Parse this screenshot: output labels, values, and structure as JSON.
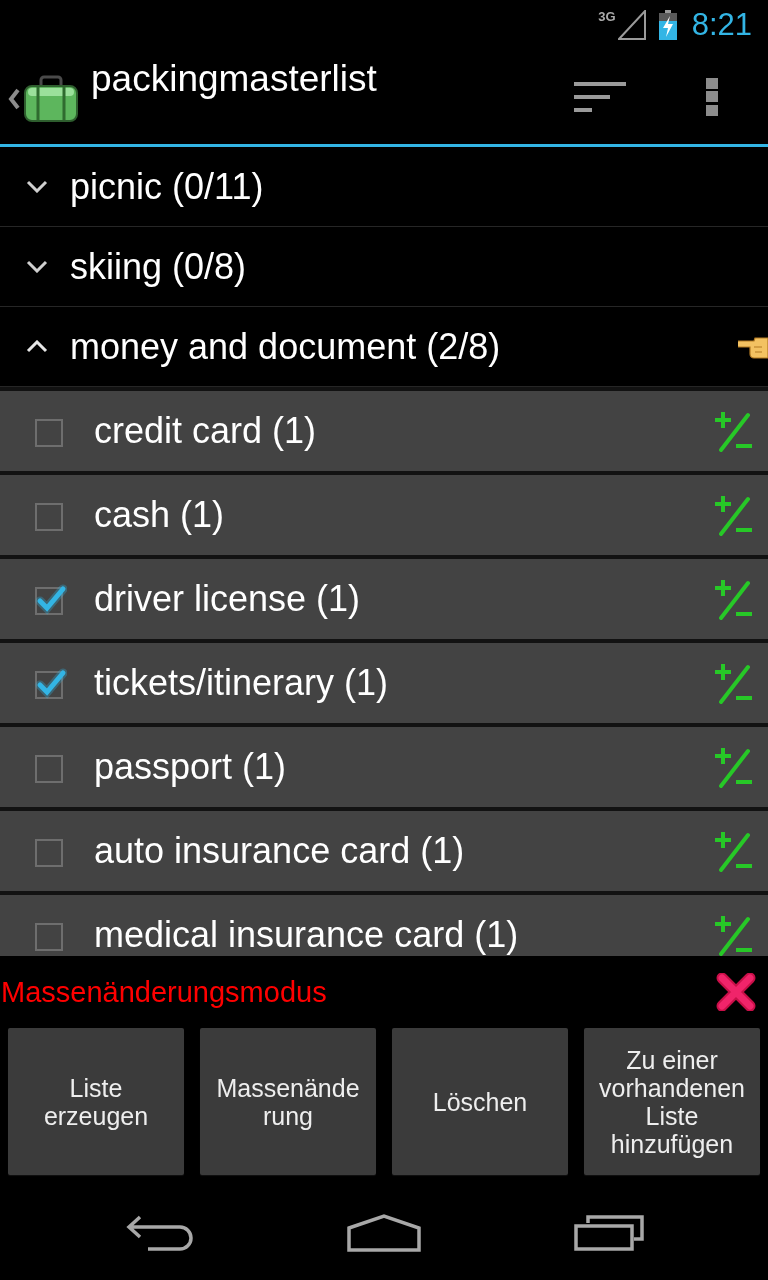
{
  "status_bar": {
    "network": "3G",
    "time": "8:21"
  },
  "action_bar": {
    "title": "packingmasterlist"
  },
  "groups": [
    {
      "label": "picnic (0/11)",
      "expanded": false,
      "selected": false
    },
    {
      "label": "skiing (0/8)",
      "expanded": false,
      "selected": false
    },
    {
      "label": "money and document (2/8)",
      "expanded": true,
      "selected": true,
      "items": [
        {
          "label": "credit card (1)",
          "checked": false
        },
        {
          "label": "cash (1)",
          "checked": false
        },
        {
          "label": "driver license (1)",
          "checked": true
        },
        {
          "label": "tickets/itinerary (1)",
          "checked": true
        },
        {
          "label": "passport (1)",
          "checked": false
        },
        {
          "label": "auto insurance card (1)",
          "checked": false
        },
        {
          "label": "medical insurance card (1)",
          "checked": false
        }
      ]
    }
  ],
  "mode_bar": {
    "label": "Massenänderungsmodus",
    "buttons": [
      "Liste erzeugen",
      "Massenände\nrung",
      "Löschen",
      "Zu einer vorhandenen Liste hinzufügen"
    ]
  }
}
